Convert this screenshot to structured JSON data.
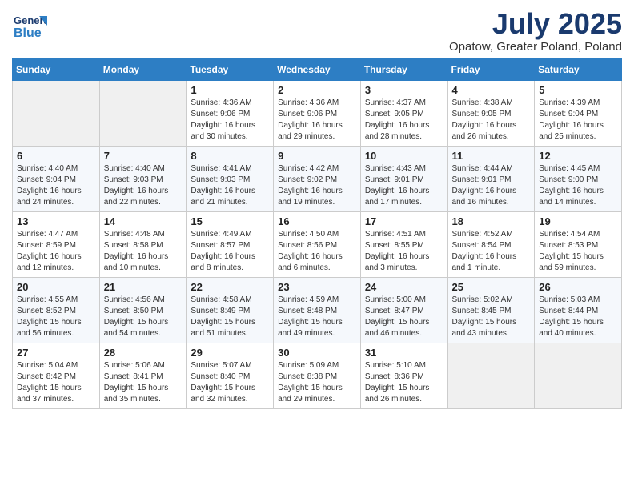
{
  "header": {
    "logo_line1": "General",
    "logo_line2": "Blue",
    "title": "July 2025",
    "subtitle": "Opatow, Greater Poland, Poland"
  },
  "weekdays": [
    "Sunday",
    "Monday",
    "Tuesday",
    "Wednesday",
    "Thursday",
    "Friday",
    "Saturday"
  ],
  "weeks": [
    [
      {
        "day": "",
        "text": ""
      },
      {
        "day": "",
        "text": ""
      },
      {
        "day": "1",
        "text": "Sunrise: 4:36 AM\nSunset: 9:06 PM\nDaylight: 16 hours\nand 30 minutes."
      },
      {
        "day": "2",
        "text": "Sunrise: 4:36 AM\nSunset: 9:06 PM\nDaylight: 16 hours\nand 29 minutes."
      },
      {
        "day": "3",
        "text": "Sunrise: 4:37 AM\nSunset: 9:05 PM\nDaylight: 16 hours\nand 28 minutes."
      },
      {
        "day": "4",
        "text": "Sunrise: 4:38 AM\nSunset: 9:05 PM\nDaylight: 16 hours\nand 26 minutes."
      },
      {
        "day": "5",
        "text": "Sunrise: 4:39 AM\nSunset: 9:04 PM\nDaylight: 16 hours\nand 25 minutes."
      }
    ],
    [
      {
        "day": "6",
        "text": "Sunrise: 4:40 AM\nSunset: 9:04 PM\nDaylight: 16 hours\nand 24 minutes."
      },
      {
        "day": "7",
        "text": "Sunrise: 4:40 AM\nSunset: 9:03 PM\nDaylight: 16 hours\nand 22 minutes."
      },
      {
        "day": "8",
        "text": "Sunrise: 4:41 AM\nSunset: 9:03 PM\nDaylight: 16 hours\nand 21 minutes."
      },
      {
        "day": "9",
        "text": "Sunrise: 4:42 AM\nSunset: 9:02 PM\nDaylight: 16 hours\nand 19 minutes."
      },
      {
        "day": "10",
        "text": "Sunrise: 4:43 AM\nSunset: 9:01 PM\nDaylight: 16 hours\nand 17 minutes."
      },
      {
        "day": "11",
        "text": "Sunrise: 4:44 AM\nSunset: 9:01 PM\nDaylight: 16 hours\nand 16 minutes."
      },
      {
        "day": "12",
        "text": "Sunrise: 4:45 AM\nSunset: 9:00 PM\nDaylight: 16 hours\nand 14 minutes."
      }
    ],
    [
      {
        "day": "13",
        "text": "Sunrise: 4:47 AM\nSunset: 8:59 PM\nDaylight: 16 hours\nand 12 minutes."
      },
      {
        "day": "14",
        "text": "Sunrise: 4:48 AM\nSunset: 8:58 PM\nDaylight: 16 hours\nand 10 minutes."
      },
      {
        "day": "15",
        "text": "Sunrise: 4:49 AM\nSunset: 8:57 PM\nDaylight: 16 hours\nand 8 minutes."
      },
      {
        "day": "16",
        "text": "Sunrise: 4:50 AM\nSunset: 8:56 PM\nDaylight: 16 hours\nand 6 minutes."
      },
      {
        "day": "17",
        "text": "Sunrise: 4:51 AM\nSunset: 8:55 PM\nDaylight: 16 hours\nand 3 minutes."
      },
      {
        "day": "18",
        "text": "Sunrise: 4:52 AM\nSunset: 8:54 PM\nDaylight: 16 hours\nand 1 minute."
      },
      {
        "day": "19",
        "text": "Sunrise: 4:54 AM\nSunset: 8:53 PM\nDaylight: 15 hours\nand 59 minutes."
      }
    ],
    [
      {
        "day": "20",
        "text": "Sunrise: 4:55 AM\nSunset: 8:52 PM\nDaylight: 15 hours\nand 56 minutes."
      },
      {
        "day": "21",
        "text": "Sunrise: 4:56 AM\nSunset: 8:50 PM\nDaylight: 15 hours\nand 54 minutes."
      },
      {
        "day": "22",
        "text": "Sunrise: 4:58 AM\nSunset: 8:49 PM\nDaylight: 15 hours\nand 51 minutes."
      },
      {
        "day": "23",
        "text": "Sunrise: 4:59 AM\nSunset: 8:48 PM\nDaylight: 15 hours\nand 49 minutes."
      },
      {
        "day": "24",
        "text": "Sunrise: 5:00 AM\nSunset: 8:47 PM\nDaylight: 15 hours\nand 46 minutes."
      },
      {
        "day": "25",
        "text": "Sunrise: 5:02 AM\nSunset: 8:45 PM\nDaylight: 15 hours\nand 43 minutes."
      },
      {
        "day": "26",
        "text": "Sunrise: 5:03 AM\nSunset: 8:44 PM\nDaylight: 15 hours\nand 40 minutes."
      }
    ],
    [
      {
        "day": "27",
        "text": "Sunrise: 5:04 AM\nSunset: 8:42 PM\nDaylight: 15 hours\nand 37 minutes."
      },
      {
        "day": "28",
        "text": "Sunrise: 5:06 AM\nSunset: 8:41 PM\nDaylight: 15 hours\nand 35 minutes."
      },
      {
        "day": "29",
        "text": "Sunrise: 5:07 AM\nSunset: 8:40 PM\nDaylight: 15 hours\nand 32 minutes."
      },
      {
        "day": "30",
        "text": "Sunrise: 5:09 AM\nSunset: 8:38 PM\nDaylight: 15 hours\nand 29 minutes."
      },
      {
        "day": "31",
        "text": "Sunrise: 5:10 AM\nSunset: 8:36 PM\nDaylight: 15 hours\nand 26 minutes."
      },
      {
        "day": "",
        "text": ""
      },
      {
        "day": "",
        "text": ""
      }
    ]
  ]
}
